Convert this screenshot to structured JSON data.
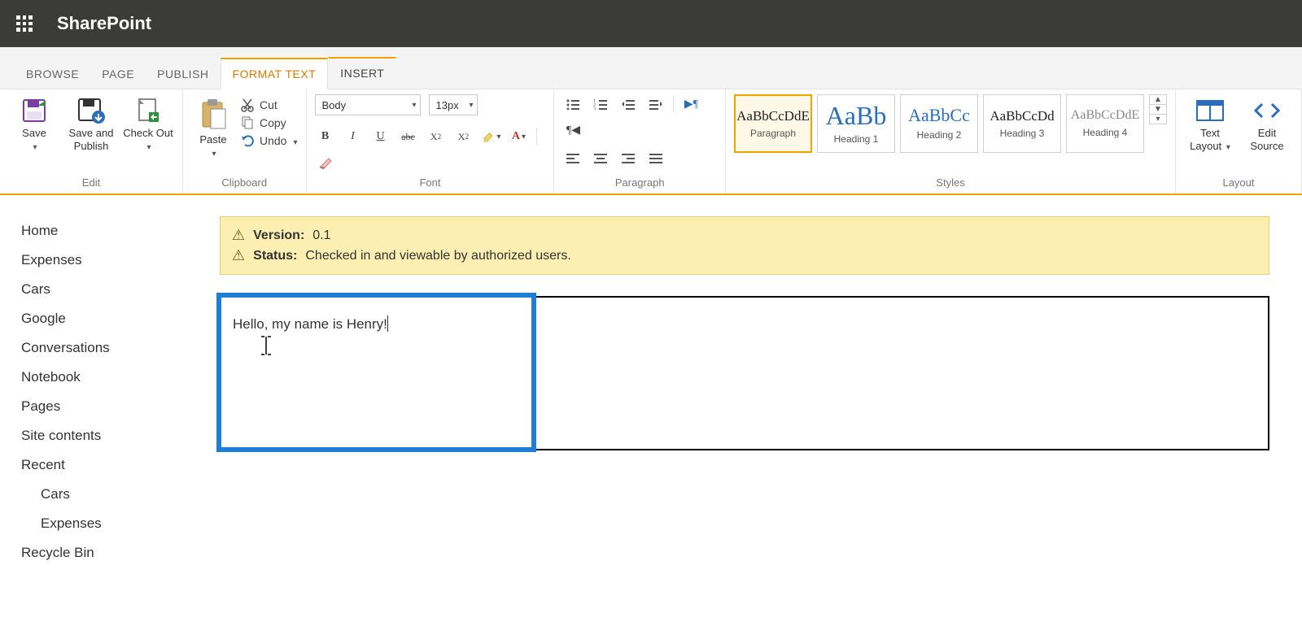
{
  "suite": {
    "app_name": "SharePoint"
  },
  "tabs": {
    "browse": "BROWSE",
    "page": "PAGE",
    "publish": "PUBLISH",
    "format_text": "FORMAT TEXT",
    "insert": "INSERT"
  },
  "ribbon": {
    "edit": {
      "label": "Edit",
      "save": "Save",
      "save_publish": "Save and Publish",
      "check_out": "Check Out"
    },
    "clipboard": {
      "label": "Clipboard",
      "paste": "Paste",
      "cut": "Cut",
      "copy": "Copy",
      "undo": "Undo"
    },
    "font": {
      "label": "Font",
      "family": "Body",
      "size": "13px"
    },
    "paragraph": {
      "label": "Paragraph"
    },
    "styles": {
      "label": "Styles",
      "items": [
        {
          "sample": "AaBbCcDdE",
          "name": "Paragraph",
          "size": "17px",
          "color": "#222"
        },
        {
          "sample": "AaBb",
          "name": "Heading 1",
          "size": "32px",
          "color": "#2a6ebb"
        },
        {
          "sample": "AaBbCc",
          "name": "Heading 2",
          "size": "22px",
          "color": "#2a6ebb"
        },
        {
          "sample": "AaBbCcDd",
          "name": "Heading 3",
          "size": "17px",
          "color": "#222"
        },
        {
          "sample": "AaBbCcDdE",
          "name": "Heading 4",
          "size": "16px",
          "color": "#888"
        }
      ]
    },
    "layout": {
      "label": "Layout",
      "text_layout": "Text Layout",
      "edit_source": "Edit Source"
    }
  },
  "nav": {
    "items": [
      "Home",
      "Expenses",
      "Cars",
      "Google",
      "Conversations",
      "Notebook",
      "Pages",
      "Site contents",
      "Recent"
    ],
    "recent_children": [
      "Cars",
      "Expenses"
    ],
    "recycle": "Recycle Bin"
  },
  "status": {
    "version_label": "Version:",
    "version_value": "0.1",
    "status_label": "Status:",
    "status_value": "Checked in and viewable by authorized users."
  },
  "editor": {
    "text": "Hello, my name is Henry!"
  }
}
